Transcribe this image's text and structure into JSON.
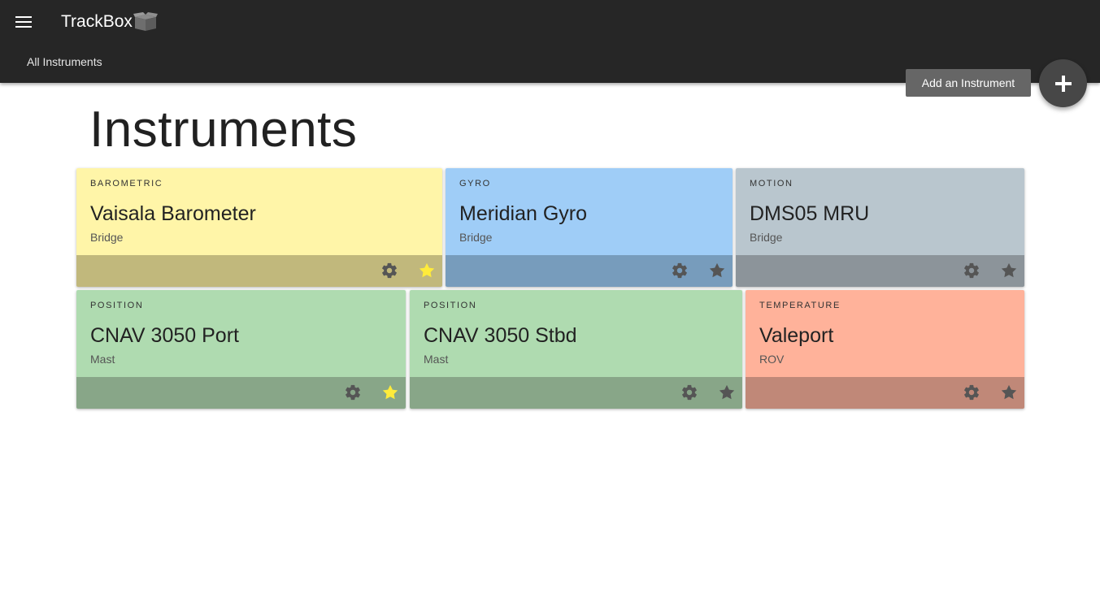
{
  "appbar": {
    "brand": "TrackBox",
    "brand_icon": "box-icon",
    "menu_icon": "hamburger-icon",
    "nav_link": "All Instruments"
  },
  "fab": {
    "tooltip": "Add an Instrument",
    "icon": "plus-icon"
  },
  "page": {
    "title": "Instruments"
  },
  "colors": {
    "appbar": "#262626",
    "star_active": "#ffeb3b",
    "icon_muted": "#555555"
  },
  "cards": [
    {
      "type": "BAROMETRIC",
      "name": "Vaisala Barometer",
      "location": "Bridge",
      "color": "yellow",
      "favorite": true
    },
    {
      "type": "GYRO",
      "name": "Meridian Gyro",
      "location": "Bridge",
      "color": "blue",
      "favorite": false
    },
    {
      "type": "MOTION",
      "name": "DMS05 MRU",
      "location": "Bridge",
      "color": "grey",
      "favorite": false
    },
    {
      "type": "POSITION",
      "name": "CNAV 3050 Port",
      "location": "Mast",
      "color": "green",
      "favorite": true
    },
    {
      "type": "POSITION",
      "name": "CNAV 3050 Stbd",
      "location": "Mast",
      "color": "green",
      "favorite": false
    },
    {
      "type": "TEMPERATURE",
      "name": "Valeport",
      "location": "ROV",
      "color": "salmon",
      "favorite": false
    }
  ]
}
